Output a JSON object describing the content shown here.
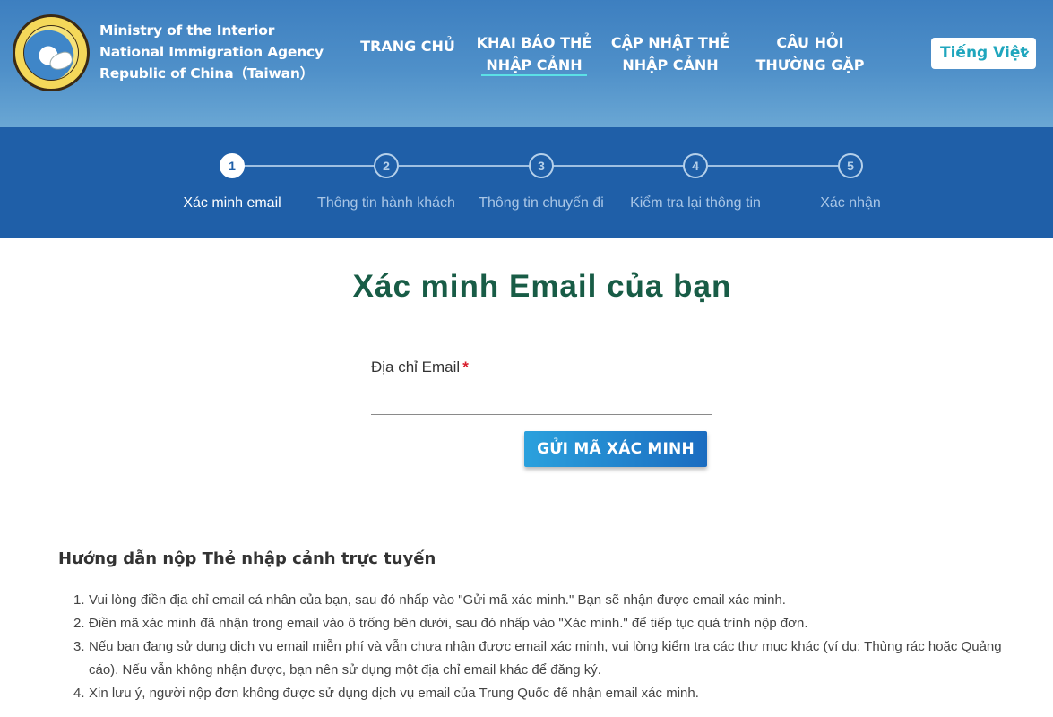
{
  "header": {
    "agency_lines": [
      "Ministry of the Interior",
      "National Immigration Agency",
      "Republic of China（Taiwan）"
    ],
    "nav": {
      "home": "TRANG CHỦ",
      "declare_line1": "KHAI BÁO THẺ",
      "declare_line2": "NHẬP CẢNH",
      "update_line1": "CẬP NHẬT THẺ",
      "update_line2": "NHẬP CẢNH",
      "faq_line1": "CÂU HỎI",
      "faq_line2": "THƯỜNG GẶP"
    },
    "language": "Tiếng Việt",
    "language_chevron": "⌵"
  },
  "stepper": {
    "steps": [
      {
        "number": "1",
        "label": "Xác minh email"
      },
      {
        "number": "2",
        "label": "Thông tin hành khách"
      },
      {
        "number": "3",
        "label": "Thông tin chuyến đi"
      },
      {
        "number": "4",
        "label": "Kiểm tra lại thông tin"
      },
      {
        "number": "5",
        "label": "Xác nhận"
      }
    ],
    "active_step": 1
  },
  "main": {
    "title": "Xác minh Email của bạn",
    "email_label": "Địa chỉ Email",
    "required_mark": "*",
    "email_value": "",
    "send_button": "GỬI MÃ XÁC MINH"
  },
  "guide": {
    "title": "Hướng dẫn nộp Thẻ nhập cảnh trực tuyến",
    "items": [
      {
        "num": "1.",
        "text": "Vui lòng điền địa chỉ email cá nhân của bạn, sau đó nhấp vào \"Gửi mã xác minh.\" Bạn sẽ nhận được email xác minh."
      },
      {
        "num": "2.",
        "text": "Điền mã xác minh đã nhận trong email vào ô trống bên dưới, sau đó nhấp vào \"Xác minh.\" để tiếp tục quá trình nộp đơn."
      },
      {
        "num": "3.",
        "text": "Nếu bạn đang sử dụng dịch vụ email miễn phí và vẫn chưa nhận được email xác minh, vui lòng kiểm tra các thư mục khác (ví dụ: Thùng rác hoặc Quảng cáo). Nếu vẫn không nhận được, bạn nên sử dụng một địa chỉ email khác để đăng ký."
      },
      {
        "num": "4.",
        "text": "Xin lưu ý, người nộp đơn không được sử dụng dịch vụ email của Trung Quốc để nhận email xác minh."
      }
    ]
  },
  "colors": {
    "header_blue": "#3d7fc0",
    "stepper_blue": "#1f5fa8",
    "title_green": "#185c46",
    "accent_cyan": "#5ce0e6",
    "button_blue": "#1b6cc0"
  }
}
